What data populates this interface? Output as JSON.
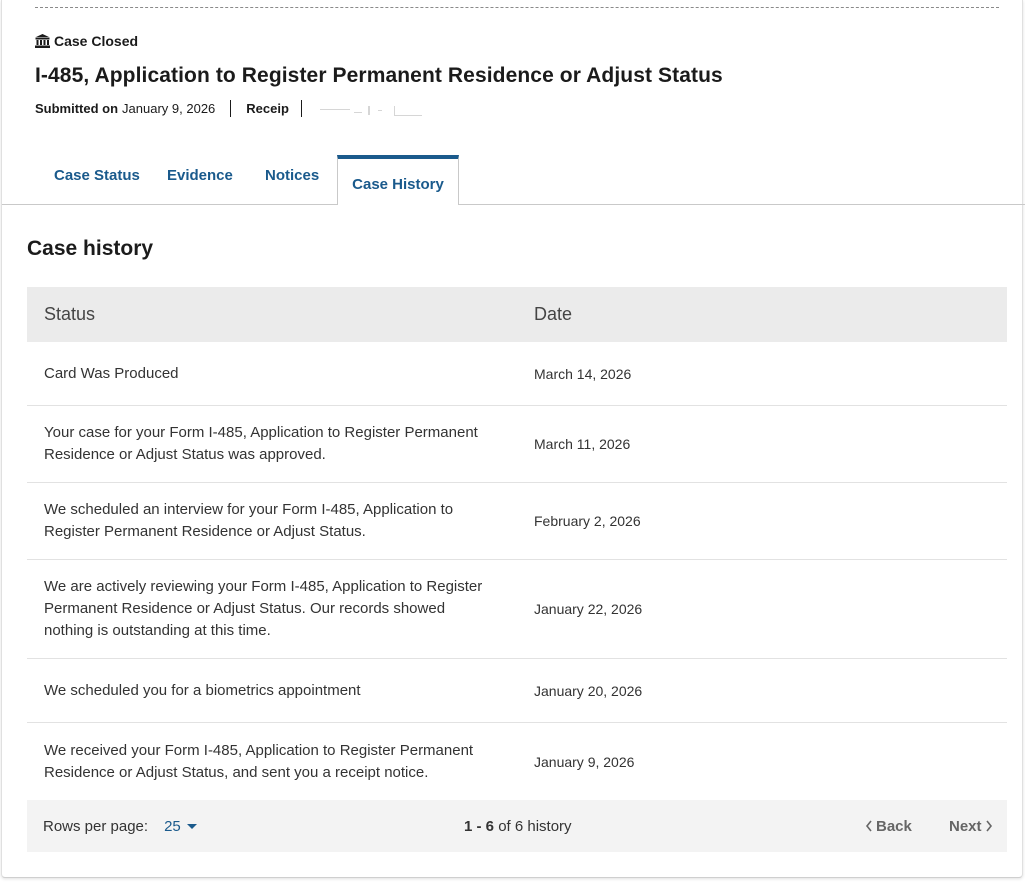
{
  "header": {
    "case_state": "Case Closed",
    "form_title": "I-485, Application to Register Permanent Residence or Adjust Status",
    "submitted_label": "Submitted on",
    "submitted_date": "January 9, 2026",
    "receipt_label": "Receip"
  },
  "tabs": [
    {
      "label": "Case Status"
    },
    {
      "label": "Evidence"
    },
    {
      "label": "Notices"
    },
    {
      "label": "Case History"
    }
  ],
  "section_title": "Case history",
  "table": {
    "headers": {
      "status": "Status",
      "date": "Date"
    },
    "rows": [
      {
        "status": "Card Was Produced",
        "date": "March 14, 2026"
      },
      {
        "status": "Your case for your Form I-485, Application to Register Permanent Residence or Adjust Status was approved.",
        "date": "March 11, 2026"
      },
      {
        "status": "We scheduled an interview for your Form I-485, Application to Register Permanent Residence or Adjust Status.",
        "date": "February 2, 2026"
      },
      {
        "status": "We are actively reviewing your Form I-485, Application to Register Permanent Residence or Adjust Status. Our records showed nothing is outstanding at this time.",
        "date": "January 22, 2026"
      },
      {
        "status": "We scheduled you for a biometrics appointment",
        "date": "January 20, 2026"
      },
      {
        "status": "We received your Form I-485, Application to Register Permanent Residence or Adjust Status, and sent you a receipt notice.",
        "date": "January 9, 2026"
      }
    ]
  },
  "pagination": {
    "rows_per_page_label": "Rows per page:",
    "rows_per_page_value": "25",
    "range": "1 - 6",
    "range_suffix": "of 6 history",
    "back_label": "Back",
    "next_label": "Next"
  },
  "colors": {
    "link": "#1a5a8c",
    "header_bg": "#ebebeb",
    "footer_bg": "#f3f3f3"
  },
  "icons": {
    "case_state": "institution-icon",
    "rows_dropdown": "caret-down-icon",
    "back": "chevron-left-icon",
    "next": "chevron-right-icon"
  }
}
